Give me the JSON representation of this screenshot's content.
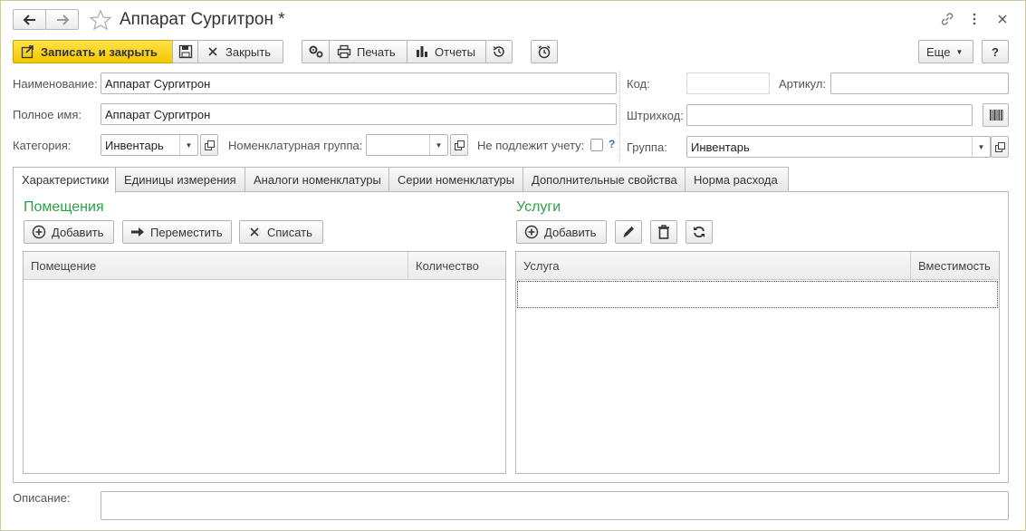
{
  "window": {
    "title": "Аппарат Сургитрон *"
  },
  "toolbar": {
    "save_close_label": "Записать и закрыть",
    "close_label": "Закрыть",
    "print_label": "Печать",
    "reports_label": "Отчеты",
    "more_label": "Еще",
    "help_label": "?"
  },
  "form": {
    "name_label": "Наименование:",
    "name_value": "Аппарат Сургитрон",
    "fullname_label": "Полное имя:",
    "fullname_value": "Аппарат Сургитрон",
    "category_label": "Категория:",
    "category_value": "Инвентарь",
    "nomgroup_label": "Номенклатурная группа:",
    "nomgroup_value": "",
    "not_accounted_label": "Не подлежит учету:",
    "not_accounted_checked": false,
    "help_mark": "?",
    "code_label": "Код:",
    "code_value": "",
    "article_label": "Артикул:",
    "article_value": "",
    "barcode_label": "Штрихкод:",
    "barcode_value": "",
    "group_label": "Группа:",
    "group_value": "Инвентарь",
    "description_label": "Описание:",
    "description_value": ""
  },
  "tabs": [
    {
      "label": "Характеристики",
      "active": true
    },
    {
      "label": "Единицы измерения"
    },
    {
      "label": "Аналоги номенклатуры"
    },
    {
      "label": "Серии номенклатуры"
    },
    {
      "label": "Дополнительные свойства"
    },
    {
      "label": "Норма расхода"
    }
  ],
  "rooms": {
    "title": "Помещения",
    "add_label": "Добавить",
    "move_label": "Переместить",
    "writeoff_label": "Списать",
    "columns": [
      "Помещение",
      "Количество"
    ],
    "rows": []
  },
  "services": {
    "title": "Услуги",
    "add_label": "Добавить",
    "columns": [
      "Услуга",
      "Вместимость"
    ],
    "rows": []
  },
  "colors": {
    "primary_button": "#f3c700",
    "section_title": "#2ea043",
    "help_mark": "#2a6fc9"
  }
}
